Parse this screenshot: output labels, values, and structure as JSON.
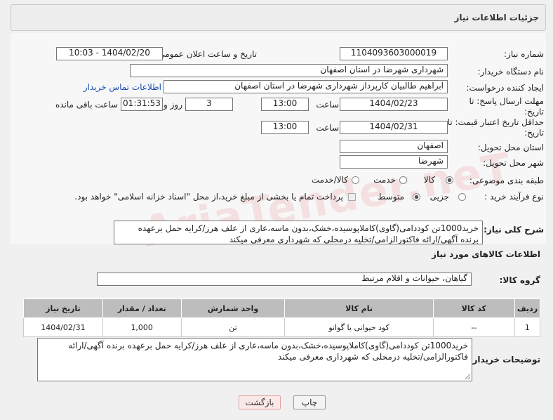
{
  "header": {
    "title": "جزئیات اطلاعات نیاز"
  },
  "form": {
    "need_number_label": "شماره نیاز:",
    "need_number": "1104093603000019",
    "announce_label": "تاریخ و ساعت اعلان عمومی:",
    "announce_value": "1404/02/20 - 10:03",
    "buyer_org_label": "نام دستگاه خریدار:",
    "buyer_org": "شهرداری شهرضا در استان اصفهان",
    "requester_label": "ایجاد کننده درخواست:",
    "requester": "ابراهیم طالبیان کارپرداز شهرداری شهرضا در استان اصفهان",
    "contact_link": "اطلاعات تماس خریدار",
    "deadline_label": "مهلت ارسال پاسخ: تا تاریخ:",
    "deadline_date": "1404/02/23",
    "time_label": "ساعت",
    "deadline_time": "13:00",
    "days_value": "3",
    "days_label": "روز و",
    "remaining_time": "01:31:53",
    "remaining_label": "ساعت باقی مانده",
    "validity_label": "حداقل تاریخ اعتبار قیمت: تا تاریخ:",
    "validity_date": "1404/02/31",
    "validity_time": "13:00",
    "province_label": "استان محل تحویل:",
    "province": "اصفهان",
    "city_label": "شهر محل تحویل:",
    "city": "شهرضا",
    "category_label": "طبقه بندی موضوعی:",
    "category_options": [
      "کالا",
      "خدمت",
      "کالا/خدمت"
    ],
    "process_label": "نوع فرآیند خرید :",
    "process_options": [
      "جزیی",
      "متوسط"
    ],
    "payment_note": "پرداخت تمام یا بخشی از مبلغ خرید،از محل \"اسناد خزانه اسلامی\" خواهد بود.",
    "summary_label": "شرح کلی نیاز:",
    "summary": "خرید1000تن کوددامی(گاوی)کاملاپوسیده،خشک،بدون ماسه،عاری از علف هرز/کرایه حمل برعهده برنده آگهی/ارائه فاکتورالزامی/تخلیه درمحلی که شهرداری معرفی میکند"
  },
  "goods": {
    "section_title": "اطلاعات کالاهای مورد نیاز",
    "group_label": "گروه کالا:",
    "group_value": "گیاهان، حیوانات و اقلام مرتبط",
    "columns": [
      "ردیف",
      "کد کالا",
      "نام کالا",
      "واحد شمارش",
      "تعداد / مقدار",
      "تاریخ نیاز"
    ],
    "rows": [
      [
        "1",
        "--",
        "کود حیوانی یا گوانو",
        "تن",
        "1,000",
        "1404/02/31"
      ]
    ]
  },
  "buyer_notes": {
    "label": "توضیحات خریدار:",
    "text": "خرید1000تن کوددامی(گاوی)کاملاپوسیده،خشک،بدون ماسه،عاری از علف هرز/کرایه حمل برعهده برنده آگهی/ارائه فاکتورالزامی/تخلیه درمحلی که شهرداری معرفی میکند"
  },
  "buttons": {
    "print": "چاپ",
    "back": "بازگشت"
  },
  "watermark": "AriaTender.neT"
}
